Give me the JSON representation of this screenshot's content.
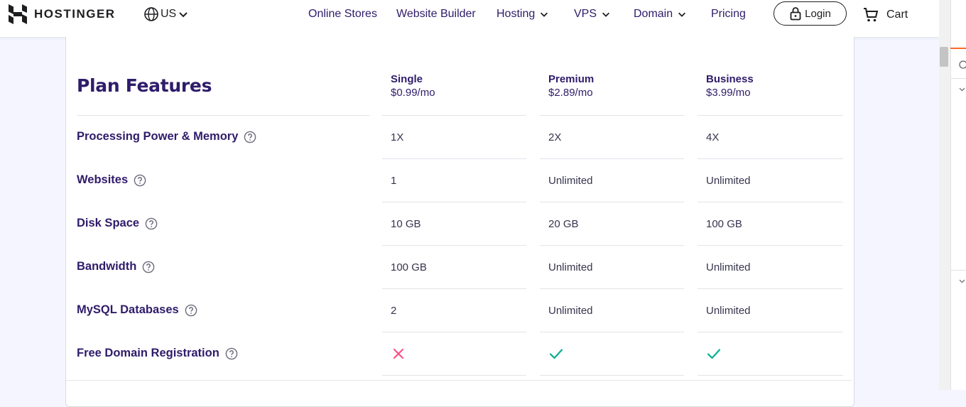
{
  "header": {
    "logo_text": "HOSTINGER",
    "locale": "US",
    "nav": [
      {
        "label": "Online Stores",
        "dropdown": false
      },
      {
        "label": "Website Builder",
        "dropdown": false
      },
      {
        "label": "Hosting",
        "dropdown": true
      },
      {
        "label": "VPS",
        "dropdown": true
      },
      {
        "label": "Domain",
        "dropdown": true
      },
      {
        "label": "Pricing",
        "dropdown": false
      }
    ],
    "login_label": "Login",
    "cart_label": "Cart"
  },
  "table": {
    "title": "Plan Features",
    "plans": [
      {
        "name": "Single",
        "price": "$0.99/mo"
      },
      {
        "name": "Premium",
        "price": "$2.89/mo"
      },
      {
        "name": "Business",
        "price": "$3.99/mo"
      }
    ],
    "rows": [
      {
        "feature": "Processing Power & Memory",
        "values": [
          "1X",
          "2X",
          "4X"
        ]
      },
      {
        "feature": "Websites",
        "values": [
          "1",
          "Unlimited",
          "Unlimited"
        ]
      },
      {
        "feature": "Disk Space",
        "values": [
          "10 GB",
          "20 GB",
          "100 GB"
        ]
      },
      {
        "feature": "Bandwidth",
        "values": [
          "100 GB",
          "Unlimited",
          "Unlimited"
        ]
      },
      {
        "feature": "MySQL Databases",
        "values": [
          "2",
          "Unlimited",
          "Unlimited"
        ]
      },
      {
        "feature": "Free Domain Registration",
        "values": [
          "cross-icon",
          "check-icon",
          "check-icon"
        ]
      }
    ]
  },
  "colors": {
    "heading": "#2f1c6a",
    "check": "#00b090",
    "cross": "#fc5185",
    "accent": "#ff6a2b"
  }
}
